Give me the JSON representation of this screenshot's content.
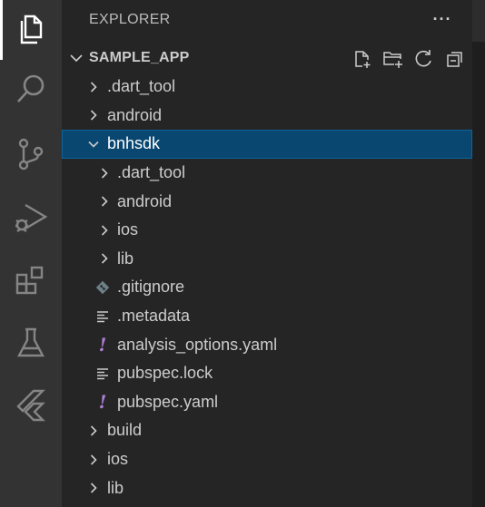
{
  "activity_bar": {
    "items": [
      {
        "name": "explorer-icon",
        "active": true
      },
      {
        "name": "search-icon",
        "active": false
      },
      {
        "name": "source-control-icon",
        "active": false
      },
      {
        "name": "run-debug-icon",
        "active": false
      },
      {
        "name": "extensions-icon",
        "active": false
      },
      {
        "name": "testing-icon",
        "active": false
      },
      {
        "name": "flutter-icon",
        "active": false
      }
    ]
  },
  "explorer": {
    "header": "EXPLORER",
    "more_actions_glyph": "···",
    "section_title": "SAMPLE_APP",
    "section_actions": [
      "new-file-icon",
      "new-folder-icon",
      "refresh-icon",
      "collapse-all-icon"
    ]
  },
  "tree": [
    {
      "label": ".dart_tool",
      "type": "folder",
      "level": 0,
      "expanded": false
    },
    {
      "label": "android",
      "type": "folder",
      "level": 0,
      "expanded": false
    },
    {
      "label": "bnhsdk",
      "type": "folder",
      "level": 0,
      "expanded": true,
      "selected": true
    },
    {
      "label": ".dart_tool",
      "type": "folder",
      "level": 1,
      "expanded": false
    },
    {
      "label": "android",
      "type": "folder",
      "level": 1,
      "expanded": false
    },
    {
      "label": "ios",
      "type": "folder",
      "level": 1,
      "expanded": false
    },
    {
      "label": "lib",
      "type": "folder",
      "level": 1,
      "expanded": false
    },
    {
      "label": ".gitignore",
      "type": "file",
      "icon": "git-icon",
      "level": 1
    },
    {
      "label": ".metadata",
      "type": "file",
      "icon": "text-file-icon",
      "level": 1
    },
    {
      "label": "analysis_options.yaml",
      "type": "file",
      "icon": "yaml-icon",
      "level": 1
    },
    {
      "label": "pubspec.lock",
      "type": "file",
      "icon": "text-file-icon",
      "level": 1
    },
    {
      "label": "pubspec.yaml",
      "type": "file",
      "icon": "yaml-icon",
      "level": 1
    },
    {
      "label": "build",
      "type": "folder",
      "level": 0,
      "expanded": false
    },
    {
      "label": "ios",
      "type": "folder",
      "level": 0,
      "expanded": false
    },
    {
      "label": "lib",
      "type": "folder",
      "level": 0,
      "expanded": false
    }
  ],
  "colors": {
    "activity_bar_bg": "#333333",
    "sidebar_bg": "#252526",
    "selection_bg": "#094771",
    "selection_border": "#0e639c",
    "yaml_icon": "#b180d7",
    "git_icon": "#6d8086"
  }
}
